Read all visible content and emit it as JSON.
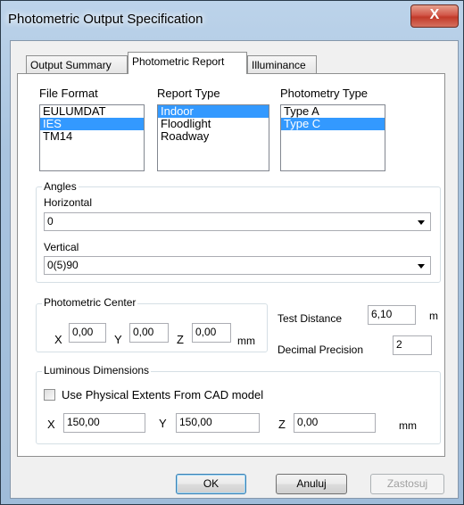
{
  "window": {
    "title": "Photometric Output Specification",
    "close_glyph": "X"
  },
  "tabs": [
    {
      "label": "Output Summary"
    },
    {
      "label": "Photometric Report"
    },
    {
      "label": "Illuminance"
    }
  ],
  "file_format": {
    "label": "File Format",
    "items": [
      "EULUMDAT",
      "IES",
      "TM14"
    ],
    "selected": "IES"
  },
  "report_type": {
    "label": "Report Type",
    "items": [
      "Indoor",
      "Floodlight",
      "Roadway"
    ],
    "selected": "Indoor"
  },
  "photometry_type": {
    "label": "Photometry Type",
    "items": [
      "Type A",
      "Type C"
    ],
    "selected": "Type C"
  },
  "angles": {
    "group_label": "Angles",
    "horizontal_label": "Horizontal",
    "horizontal_value": "0",
    "vertical_label": "Vertical",
    "vertical_value": "0(5)90"
  },
  "photometric_center": {
    "group_label": "Photometric Center",
    "x_label": "X",
    "x_value": "0,00",
    "y_label": "Y",
    "y_value": "0,00",
    "z_label": "Z",
    "z_value": "0,00",
    "unit": "mm"
  },
  "test_distance": {
    "label": "Test Distance",
    "value": "6,10",
    "unit": "m"
  },
  "decimal_precision": {
    "label": "Decimal Precision",
    "value": "2"
  },
  "luminous_dimensions": {
    "group_label": "Luminous Dimensions",
    "checkbox_label": "Use Physical Extents From CAD model",
    "checked": false,
    "x_label": "X",
    "x_value": "150,00",
    "y_label": "Y",
    "y_value": "150,00",
    "z_label": "Z",
    "z_value": "0,00",
    "unit": "mm"
  },
  "buttons": {
    "ok": "OK",
    "cancel": "Anuluj",
    "apply": "Zastosuj"
  }
}
